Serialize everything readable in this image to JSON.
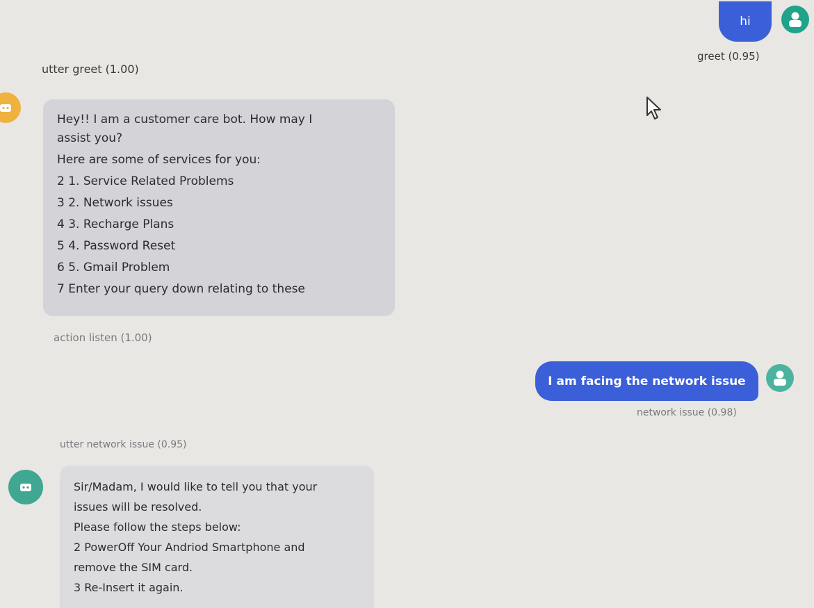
{
  "conversation": {
    "user_msg_1": {
      "text": "hi",
      "intent": "greet (0.95)"
    },
    "bot_action_1": "utter greet (1.00)",
    "bot_msg_1": {
      "lines": [
        "Hey!! I am a customer care bot. How may I",
        "assist you?",
        "Here are some of services for you:",
        "2 1. Service Related Problems",
        "3 2. Network issues",
        "4 3. Recharge Plans",
        "5 4. Password Reset",
        "6 5. Gmail Problem",
        "7 Enter your query down relating to these"
      ]
    },
    "bot_action_2": "action listen (1.00)",
    "user_msg_2": {
      "text": "I am facing the network issue",
      "intent": "network issue (0.98)"
    },
    "bot_action_3": "utter network issue (0.95)",
    "bot_msg_2": {
      "lines": [
        "Sir/Madam, I would like to tell you that your",
        "issues will be resolved.",
        "Please follow the steps below:",
        "2 PowerOff Your Andriod Smartphone and",
        "remove the SIM card.",
        "3 Re-Insert it again."
      ]
    }
  },
  "colors": {
    "user_bubble": "#3b5fd9",
    "bot_bubble": "#d3d3d8",
    "avatar": "#1fa38a",
    "background": "#e9e7e3"
  }
}
